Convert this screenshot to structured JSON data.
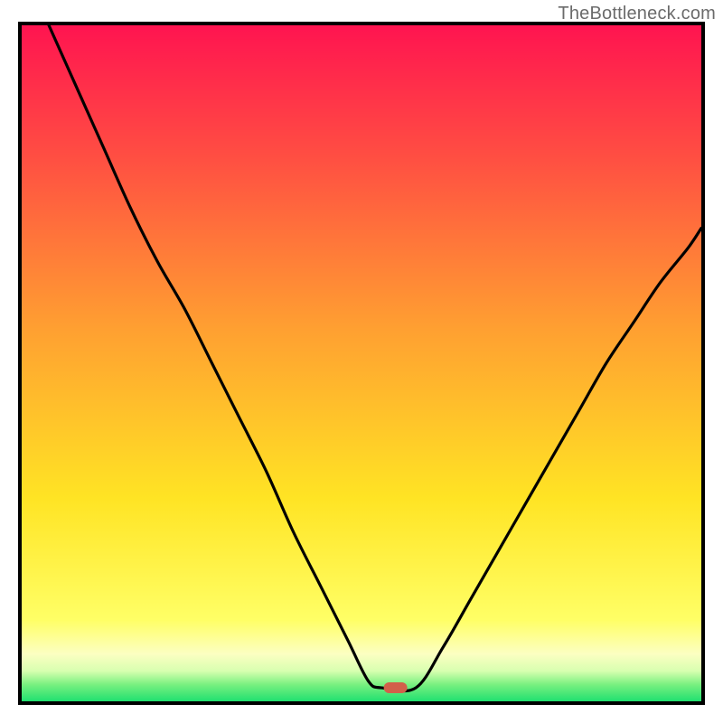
{
  "watermark": "TheBottleneck.com",
  "chart_data": {
    "type": "line",
    "title": "",
    "xlabel": "",
    "ylabel": "",
    "xlim": [
      0,
      100
    ],
    "ylim": [
      0,
      100
    ],
    "legend": false,
    "grid": false,
    "background_gradient": {
      "stops": [
        {
          "pos": 0.0,
          "color": "#ff1450"
        },
        {
          "pos": 0.2,
          "color": "#ff5042"
        },
        {
          "pos": 0.45,
          "color": "#ffa031"
        },
        {
          "pos": 0.7,
          "color": "#ffe424"
        },
        {
          "pos": 0.88,
          "color": "#ffff66"
        },
        {
          "pos": 0.93,
          "color": "#fcffc2"
        },
        {
          "pos": 0.955,
          "color": "#d8ffb0"
        },
        {
          "pos": 0.975,
          "color": "#7af080"
        },
        {
          "pos": 1.0,
          "color": "#20e070"
        }
      ]
    },
    "marker": {
      "x": 55,
      "y": 2,
      "color": "#d2604a",
      "shape": "pill"
    },
    "series": [
      {
        "name": "left-curve",
        "x": [
          4,
          8,
          12,
          16,
          20,
          24,
          28,
          32,
          36,
          40,
          44,
          48,
          51,
          53
        ],
        "y": [
          100,
          91,
          82,
          73,
          65,
          58,
          50,
          42,
          34,
          25,
          17,
          9,
          3,
          2
        ]
      },
      {
        "name": "flat-bottom",
        "x": [
          53,
          58
        ],
        "y": [
          2,
          2
        ]
      },
      {
        "name": "right-curve",
        "x": [
          58,
          62,
          66,
          70,
          74,
          78,
          82,
          86,
          90,
          94,
          98,
          100
        ],
        "y": [
          2,
          8,
          15,
          22,
          29,
          36,
          43,
          50,
          56,
          62,
          67,
          70
        ]
      }
    ]
  }
}
